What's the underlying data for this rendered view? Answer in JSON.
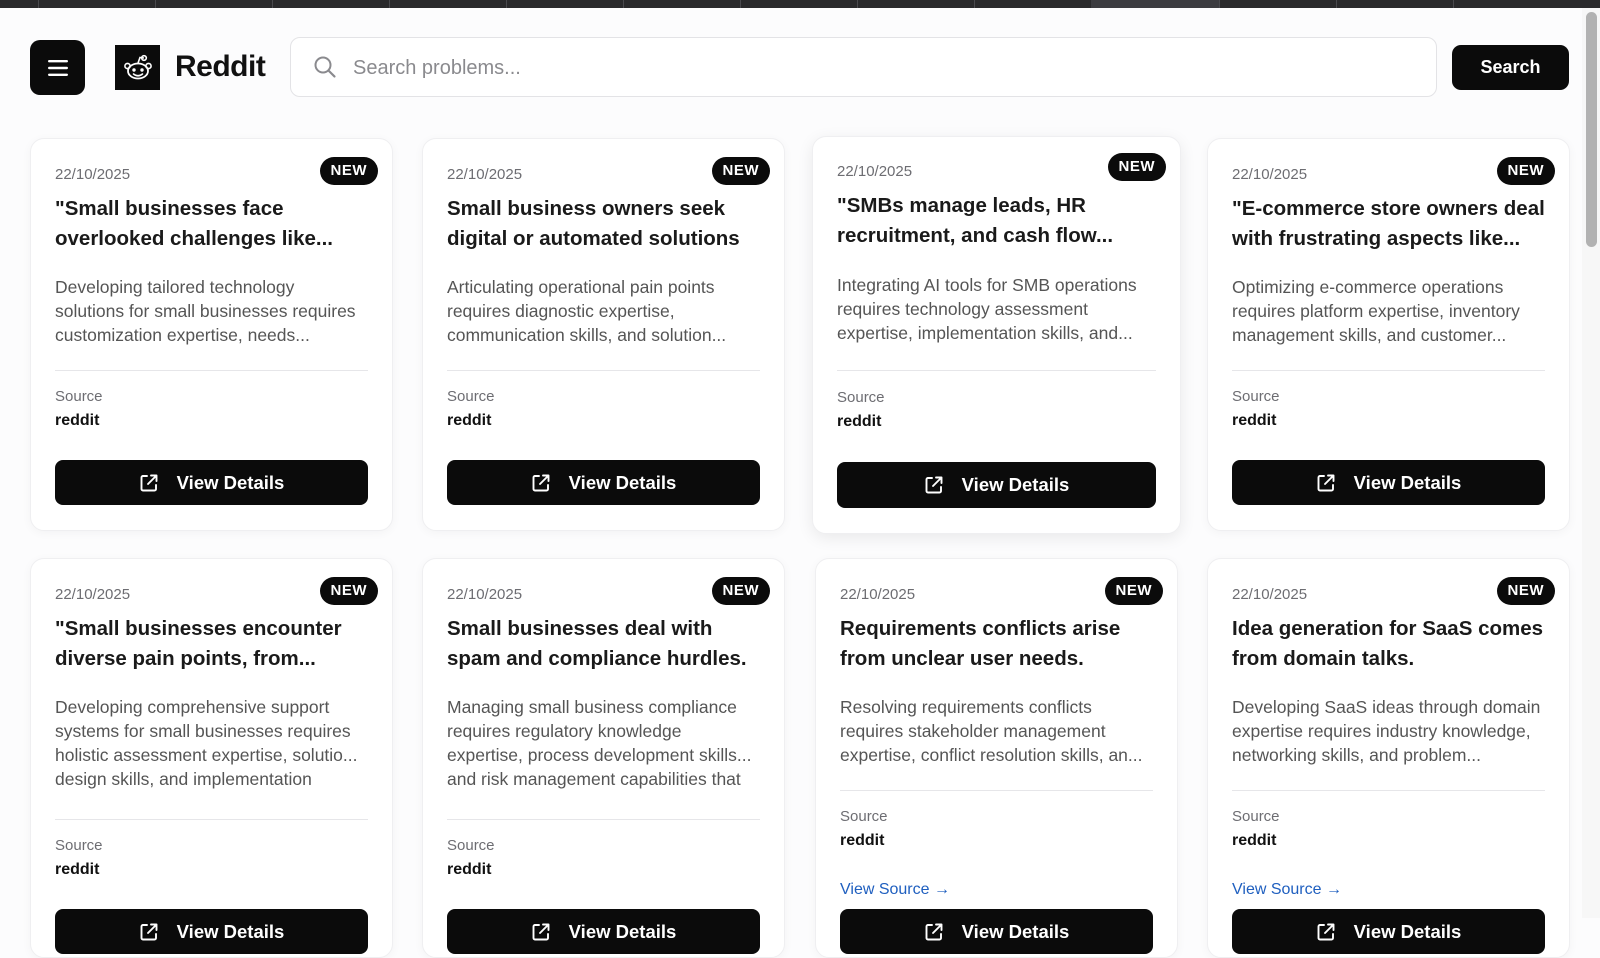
{
  "header": {
    "brand": "Reddit",
    "search_placeholder": "Search problems...",
    "search_label": "Search"
  },
  "cards": [
    {
      "date": "22/10/2025",
      "badge": "NEW",
      "title": "\"Small businesses face overlooked challenges like...",
      "description": "Developing tailored technology solutions for small businesses requires customization expertise, needs...",
      "source_label": "Source",
      "source": "reddit",
      "button": "View Details"
    },
    {
      "date": "22/10/2025",
      "badge": "NEW",
      "title": "Small business owners seek digital or automated solutions f...",
      "description": "Articulating operational pain points requires diagnostic expertise, communication skills, and solution...",
      "source_label": "Source",
      "source": "reddit",
      "button": "View Details"
    },
    {
      "date": "22/10/2025",
      "badge": "NEW",
      "title": "\"SMBs manage leads, HR recruitment, and cash flow...",
      "description": "Integrating AI tools for SMB operations requires technology assessment expertise, implementation skills, and...",
      "source_label": "Source",
      "source": "reddit",
      "button": "View Details"
    },
    {
      "date": "22/10/2025",
      "badge": "NEW",
      "title": "\"E-commerce store owners deal with frustrating aspects like...",
      "description": "Optimizing e-commerce operations requires platform expertise, inventory management skills, and customer...",
      "source_label": "Source",
      "source": "reddit",
      "button": "View Details"
    },
    {
      "date": "22/10/2025",
      "badge": "NEW",
      "title": "\"Small businesses encounter diverse pain points, from...",
      "description": "Developing comprehensive support systems for small businesses requires holistic assessment expertise, solutio... design skills, and implementation",
      "source_label": "Source",
      "source": "reddit",
      "button": "View Details"
    },
    {
      "date": "22/10/2025",
      "badge": "NEW",
      "title": "Small businesses deal with spam and compliance hurdles.",
      "description": "Managing small business compliance requires regulatory knowledge expertise, process development skills... and risk management capabilities that",
      "source_label": "Source",
      "source": "reddit",
      "button": "View Details"
    },
    {
      "date": "22/10/2025",
      "badge": "NEW",
      "title": "Requirements conflicts arise from unclear user needs.",
      "description": "Resolving requirements conflicts requires stakeholder management expertise, conflict resolution skills, an...",
      "source_label": "Source",
      "source": "reddit",
      "view_source": "View Source →",
      "button": "View Details"
    },
    {
      "date": "22/10/2025",
      "badge": "NEW",
      "title": "Idea generation for SaaS comes from domain talks.",
      "description": "Developing SaaS ideas through domain expertise requires industry knowledge, networking skills, and problem...",
      "source_label": "Source",
      "source": "reddit",
      "view_source": "View Source →",
      "button": "View Details"
    }
  ]
}
